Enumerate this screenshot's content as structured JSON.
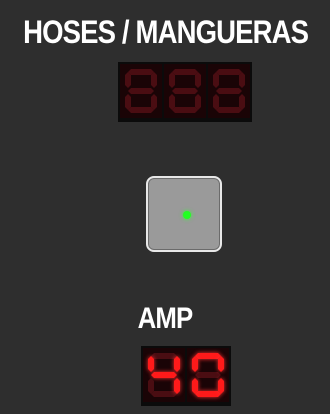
{
  "hoses": {
    "title": "HOSES / MANGUERAS",
    "display_value": "888",
    "display_lit": false
  },
  "button": {
    "led_state": "on",
    "led_color": "#22ff22"
  },
  "amp": {
    "title": "AMP",
    "display_value": "40",
    "display_lit": true
  },
  "colors": {
    "panel": "#2e2e2e",
    "segment_on": "#ff1a1a",
    "segment_off": "#4a0d12",
    "title_text": "#ffffff"
  }
}
